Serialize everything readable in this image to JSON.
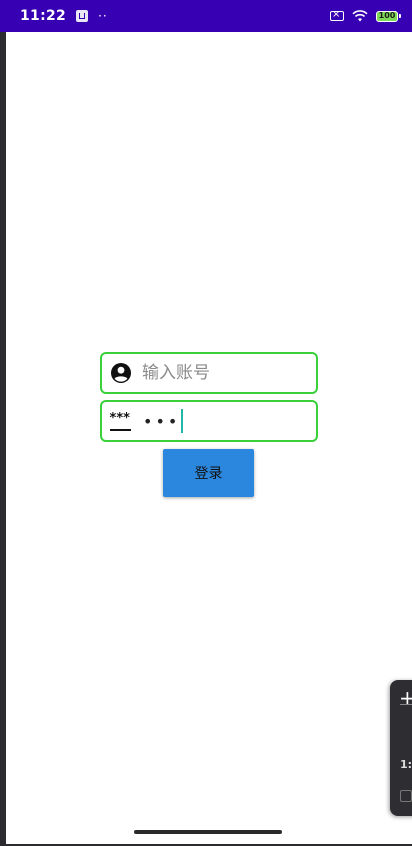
{
  "status_bar": {
    "time": "11:22",
    "app_icon": "notification-app-icon",
    "dots": "··",
    "battery_level": "100",
    "icons": [
      "no-sim-icon",
      "wifi-icon",
      "battery-icon"
    ],
    "background_color": "#3700b3"
  },
  "login_form": {
    "username": {
      "placeholder": "输入账号",
      "value": "",
      "icon": "account-circle-icon"
    },
    "password": {
      "masked_value": "•••",
      "icon": "password-icon",
      "icon_glyph": "***"
    },
    "login_button_label": "登录",
    "border_color": "#3ad03a",
    "button_color": "#2b87dd"
  },
  "floating_panel": {
    "plus": "+",
    "ratio_label": "1:"
  }
}
